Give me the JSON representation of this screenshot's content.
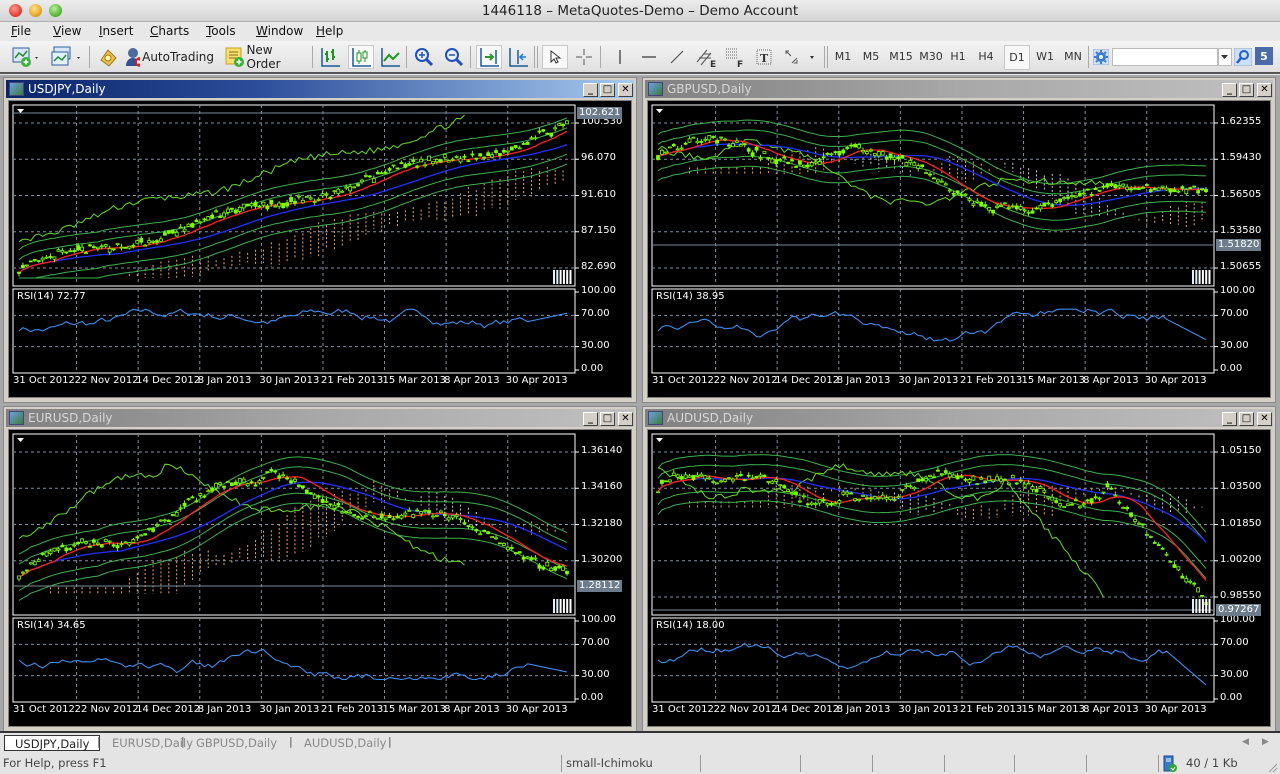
{
  "window": {
    "title": "1446118 – MetaQuotes-Demo – Demo Account"
  },
  "menu": [
    {
      "label": "File",
      "u": "F",
      "rest": "ile"
    },
    {
      "label": "View",
      "u": "V",
      "rest": "iew"
    },
    {
      "label": "Insert",
      "u": "I",
      "rest": "nsert"
    },
    {
      "label": "Charts",
      "u": "C",
      "rest": "harts"
    },
    {
      "label": "Tools",
      "u": "T",
      "rest": "ools"
    },
    {
      "label": "Window",
      "u": "W",
      "rest": "indow"
    },
    {
      "label": "Help",
      "u": "H",
      "rest": "elp"
    }
  ],
  "toolbar": {
    "autotrading_label": "AutoTrading",
    "new_order_label": "New Order",
    "timeframes": [
      "M1",
      "M5",
      "M15",
      "M30",
      "H1",
      "H4",
      "D1",
      "W1",
      "MN"
    ],
    "active_timeframe": "D1",
    "search_value": "",
    "notification_count": "5"
  },
  "charts": [
    {
      "id": "usdjpy",
      "title": "USDJPY,Daily",
      "active": true,
      "price_labels": [
        "100.530",
        "96.070",
        "91.610",
        "87.150",
        "82.690"
      ],
      "current_price": "102.621",
      "rsi_label": "RSI(14) 72.77",
      "rsi_levels": [
        "100.00",
        "70.00",
        "30.00",
        "0.00"
      ],
      "dates": [
        "31 Oct 2012",
        "22 Nov 2012",
        "14 Dec 2012",
        "8 Jan 2013",
        "30 Jan 2013",
        "21 Feb 2013",
        "15 Mar 2013",
        "8 Apr 2013",
        "30 Apr 2013"
      ],
      "trend": "up"
    },
    {
      "id": "gbpusd",
      "title": "GBPUSD,Daily",
      "active": false,
      "price_labels": [
        "1.62355",
        "1.59430",
        "1.56505",
        "1.53580",
        "1.50655"
      ],
      "current_price": "1.51820",
      "rsi_label": "RSI(14) 38.95",
      "rsi_levels": [
        "100.00",
        "70.00",
        "30.00",
        "0.00"
      ],
      "dates": [
        "31 Oct 2012",
        "22 Nov 2012",
        "14 Dec 2012",
        "8 Jan 2013",
        "30 Jan 2013",
        "21 Feb 2013",
        "15 Mar 2013",
        "8 Apr 2013",
        "30 Apr 2013"
      ],
      "trend": "downup"
    },
    {
      "id": "eurusd",
      "title": "EURUSD,Daily",
      "active": false,
      "price_labels": [
        "1.36140",
        "1.34160",
        "1.32180",
        "1.30200"
      ],
      "current_price": "1.28112",
      "rsi_label": "RSI(14) 34.65",
      "rsi_levels": [
        "100.00",
        "70.00",
        "30.00",
        "0.00"
      ],
      "dates": [
        "31 Oct 2012",
        "22 Nov 2012",
        "14 Dec 2012",
        "8 Jan 2013",
        "30 Jan 2013",
        "21 Feb 2013",
        "15 Mar 2013",
        "8 Apr 2013",
        "30 Apr 2013"
      ],
      "trend": "humpdown"
    },
    {
      "id": "audusd",
      "title": "AUDUSD,Daily",
      "active": false,
      "price_labels": [
        "1.05150",
        "1.03500",
        "1.01850",
        "1.00200",
        "0.98550"
      ],
      "current_price": "0.97267",
      "rsi_label": "RSI(14) 18.00",
      "rsi_levels": [
        "100.00",
        "70.00",
        "30.00",
        "0.00"
      ],
      "dates": [
        "31 Oct 2012",
        "22 Nov 2012",
        "14 Dec 2012",
        "8 Jan 2013",
        "30 Jan 2013",
        "21 Feb 2013",
        "15 Mar 2013",
        "8 Apr 2013",
        "30 Apr 2013"
      ],
      "trend": "flatdrop"
    }
  ],
  "tabs": [
    {
      "label": "USDJPY,Daily",
      "active": true
    },
    {
      "label": "EURUSD,Daily",
      "active": false
    },
    {
      "label": "GBPUSD,Daily",
      "active": false
    },
    {
      "label": "AUDUSD,Daily",
      "active": false
    }
  ],
  "status": {
    "help_text": "For Help, press F1",
    "profile": "small-Ichimoku",
    "connection": "40 / 1 Kb"
  },
  "colors": {
    "candle": "#7cfc00",
    "kijun": "#ff2020",
    "tenkan": "#2030ff",
    "bands": "#3cb04c",
    "chikou": "#66dd22",
    "cloud_a": "#f4a460",
    "cloud_b": "#d8c8e0",
    "rsi": "#3c8cf0",
    "grid": "#8090a0"
  }
}
